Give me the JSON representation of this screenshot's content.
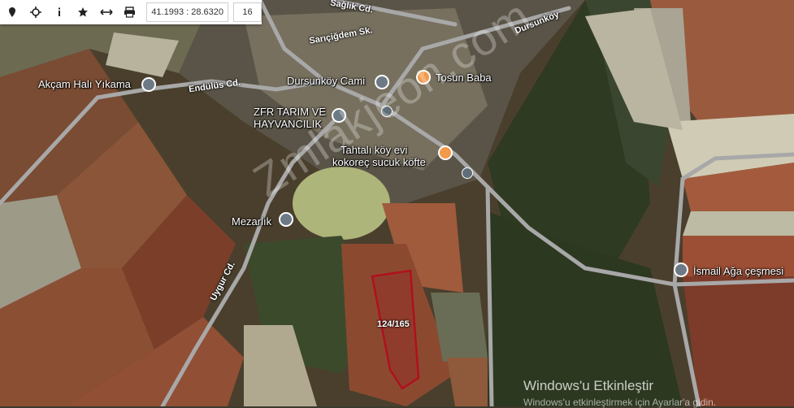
{
  "toolbar": {
    "icons": [
      "marker-icon",
      "crosshair-icon",
      "info-icon",
      "star-icon",
      "measure-icon",
      "print-icon"
    ],
    "coordinates": "41.1993 : 28.6320",
    "zoom": "16"
  },
  "places": {
    "akcam_hali": "Akçam Halı Yıkama",
    "dursunkoy_cami": "Dursunköy Cami",
    "tosun_baba": "Tosun Baba",
    "zfr_tarim_line1": "ZFR TARIM VE",
    "zfr_tarim_line2": "HAYVANCILIK",
    "tahtali_line1": "Tahtalı köy evi",
    "tahtali_line2": "kokoreç sucuk köfte",
    "mezarlik": "Mezarlık",
    "ismail_aga": "İsmail Ağa çeşmesi"
  },
  "roads": {
    "saglik": "Sağlık Cd.",
    "saricigdem": "Sarıçiğdem Sk.",
    "dursunkoy": "Dursunköy",
    "endulus": "Endülüs Cd.",
    "uygur": "Uygur Cd."
  },
  "parcel": {
    "label": "124/165"
  },
  "watermark": "Zmlakjeon.com",
  "windows_notice": {
    "title": "Windows'u Etkinleştir",
    "subtitle": "Windows'u etkinleştirmek için Ayarlar'a gidin."
  },
  "colors": {
    "parcel_outline": "#b0101e",
    "road": "#9a9a9a",
    "poi_gray": "#6d7a86",
    "poi_orange": "#f2994a"
  }
}
